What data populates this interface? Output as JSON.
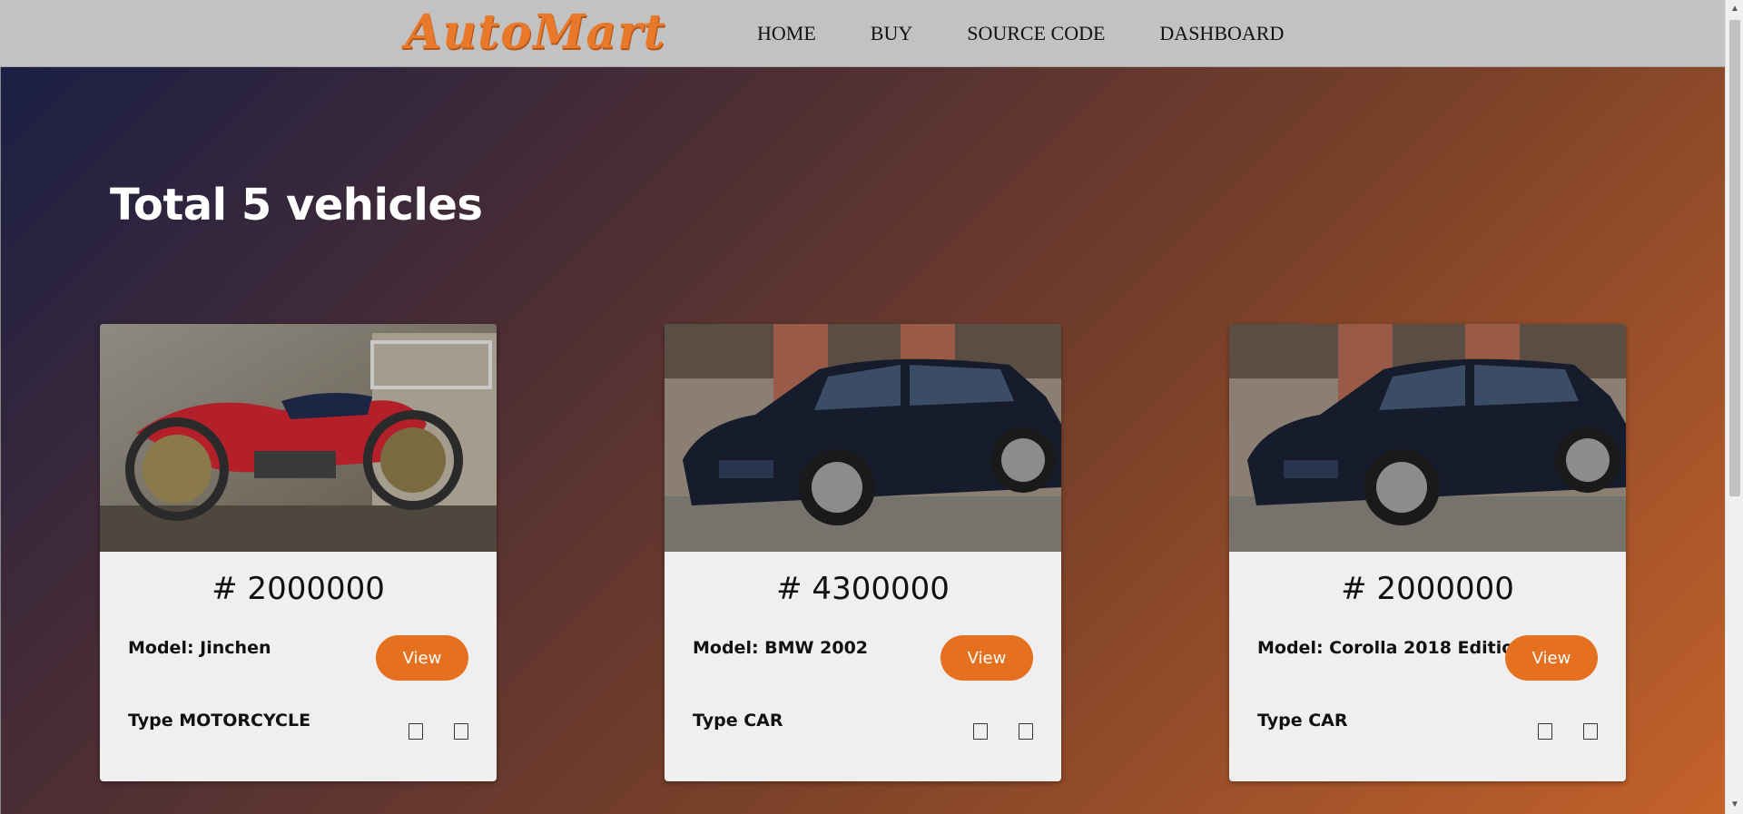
{
  "navbar": {
    "logo": "AutoMart",
    "links": [
      "HOME",
      "BUY",
      "SOURCE CODE",
      "DASHBOARD"
    ]
  },
  "main": {
    "title": "Total 5 vehicles"
  },
  "cards": [
    {
      "price": "# 2000000",
      "model": "Model: Jinchen",
      "type": "Type MOTORCYCLE",
      "view_label": "View",
      "image": "red-motorcycle"
    },
    {
      "price": "# 4300000",
      "model": "Model: BMW 2002",
      "type": "Type CAR",
      "view_label": "View",
      "image": "black-sedan"
    },
    {
      "price": "# 2000000",
      "model": "Model: Corolla 2018 Edition",
      "type": "Type CAR",
      "view_label": "View",
      "image": "black-sedan"
    }
  ],
  "colors": {
    "accent": "#e5701f",
    "logo": "#e8782a",
    "navbar": "#c2c2c2"
  },
  "icons": [
    "edit-icon",
    "delete-icon",
    "scroll-up-arrow-icon",
    "scroll-down-arrow-icon"
  ]
}
